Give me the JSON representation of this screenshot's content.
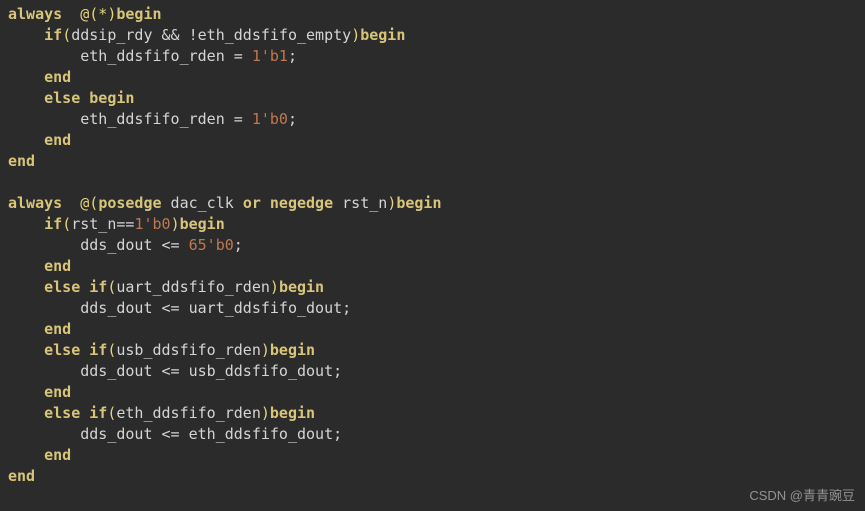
{
  "code": {
    "l1_always": "always",
    "l1_at": "  @(*)",
    "l1_begin": "begin",
    "l2_if": "if",
    "l2_cond_open": "(",
    "l2_cond_body": "ddsip_rdy && !eth_ddsfifo_empty",
    "l2_cond_close": ")",
    "l2_begin": "begin",
    "l3_stmt_lhs": "eth_ddsfifo_rden = ",
    "l3_num": "1'b1",
    "l3_semi": ";",
    "l4_end": "end",
    "l5_else": "else",
    "l5_begin": " begin",
    "l6_stmt_lhs": "eth_ddsfifo_rden = ",
    "l6_num": "1'b0",
    "l6_semi": ";",
    "l7_end": "end",
    "l8_end": "end",
    "l10_always": "always",
    "l10_at1": "  @(",
    "l10_posedge": "posedge",
    "l10_clk": " dac_clk ",
    "l10_or": "or",
    "l10_sp": " ",
    "l10_negedge": "negedge",
    "l10_rst": " rst_n",
    "l10_close": ")",
    "l10_begin": "begin",
    "l11_if": "if",
    "l11_open": "(",
    "l11_lhs": "rst_n",
    "l11_eq": "==",
    "l11_num": "1'b0",
    "l11_close": ")",
    "l11_begin": "begin",
    "l12_lhs": "dds_dout <= ",
    "l12_num": "65'b0",
    "l12_semi": ";",
    "l13_end": "end",
    "l14_elseif": "else if",
    "l14_open": "(",
    "l14_cond": "uart_ddsfifo_rden",
    "l14_close": ")",
    "l14_begin": "begin",
    "l15_stmt": "dds_dout <= uart_ddsfifo_dout;",
    "l16_end": "end",
    "l17_elseif": "else if",
    "l17_open": "(",
    "l17_cond": "usb_ddsfifo_rden",
    "l17_close": ")",
    "l17_begin": "begin",
    "l18_stmt": "dds_dout <= usb_ddsfifo_dout;",
    "l19_end": "end",
    "l20_elseif": "else if",
    "l20_open": "(",
    "l20_cond": "eth_ddsfifo_rden",
    "l20_close": ")",
    "l20_begin": "begin",
    "l21_stmt": "dds_dout <= eth_ddsfifo_dout;",
    "l22_end": "end",
    "l23_end": "end"
  },
  "watermark": "CSDN @青青豌豆"
}
